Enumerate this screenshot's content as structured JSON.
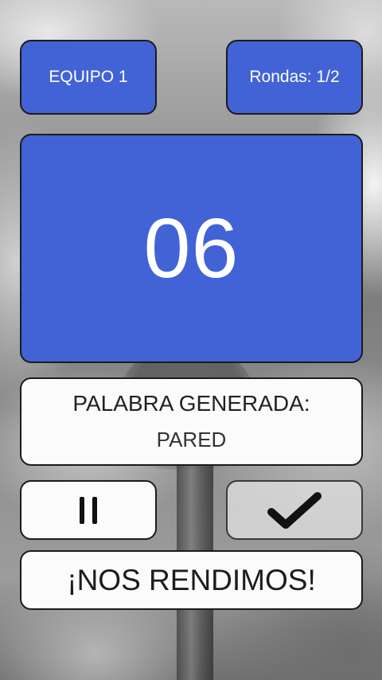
{
  "header": {
    "team_label": "EQUIPO 1",
    "rounds_label": "Rondas: 1/2"
  },
  "timer": {
    "value": "06"
  },
  "word_card": {
    "label": "PALABRA GENERADA:",
    "word": "PARED"
  },
  "controls": {
    "pause_icon": "pause-icon",
    "confirm_icon": "checkmark-icon",
    "give_up_label": "¡NOS RENDIMOS!"
  },
  "colors": {
    "accent": "#4263d6",
    "card_bg": "#fbfbfb",
    "border": "#1b1b1b"
  }
}
